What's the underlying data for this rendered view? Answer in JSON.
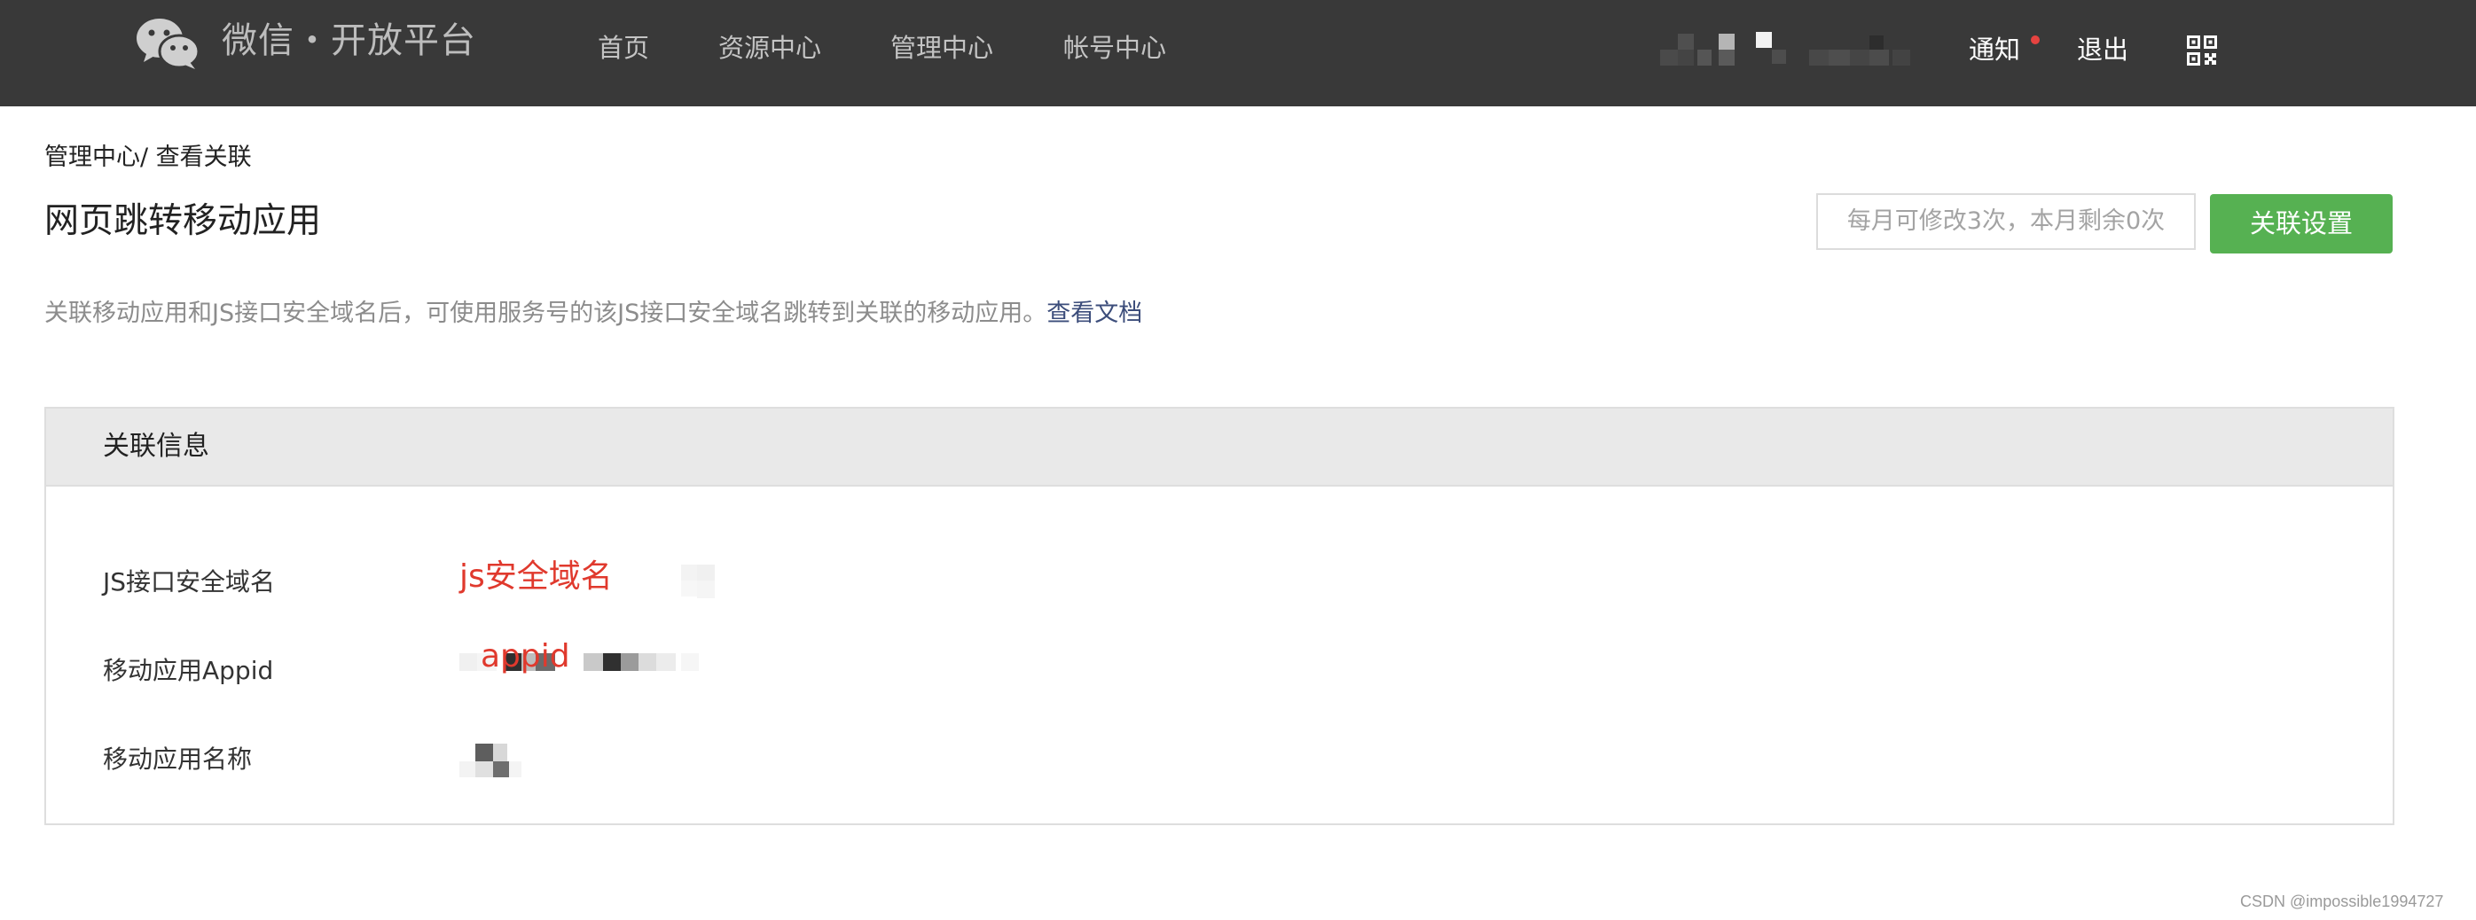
{
  "header": {
    "logo_text": "微信・开放平台",
    "nav": [
      "首页",
      "资源中心",
      "管理中心",
      "帐号中心"
    ],
    "notice_label": "通知",
    "logout_label": "退出",
    "icons": {
      "logo": "wechat-logo-icon",
      "qr": "qr-code-icon"
    }
  },
  "breadcrumb": "管理中心/ 查看关联",
  "page_title": "网页跳转移动应用",
  "limit_text": "每月可修改3次，本月剩余0次",
  "settings_button": "关联设置",
  "description": {
    "text": "关联移动应用和JS接口安全域名后，可使用服务号的该JS接口安全域名跳转到关联的移动应用。",
    "link": "查看文档"
  },
  "panel": {
    "title": "关联信息",
    "rows": [
      {
        "label": "JS接口安全域名",
        "annotation": "js安全域名"
      },
      {
        "label": "移动应用Appid",
        "annotation": "appid"
      },
      {
        "label": "移动应用名称"
      }
    ]
  },
  "watermark": "CSDN @impossible1994727",
  "colors": {
    "topbar": "#393939",
    "accent_green": "#56b152",
    "link": "#3c4d7b",
    "annotation_red": "#e0392d",
    "notice_dot": "#e64340"
  }
}
